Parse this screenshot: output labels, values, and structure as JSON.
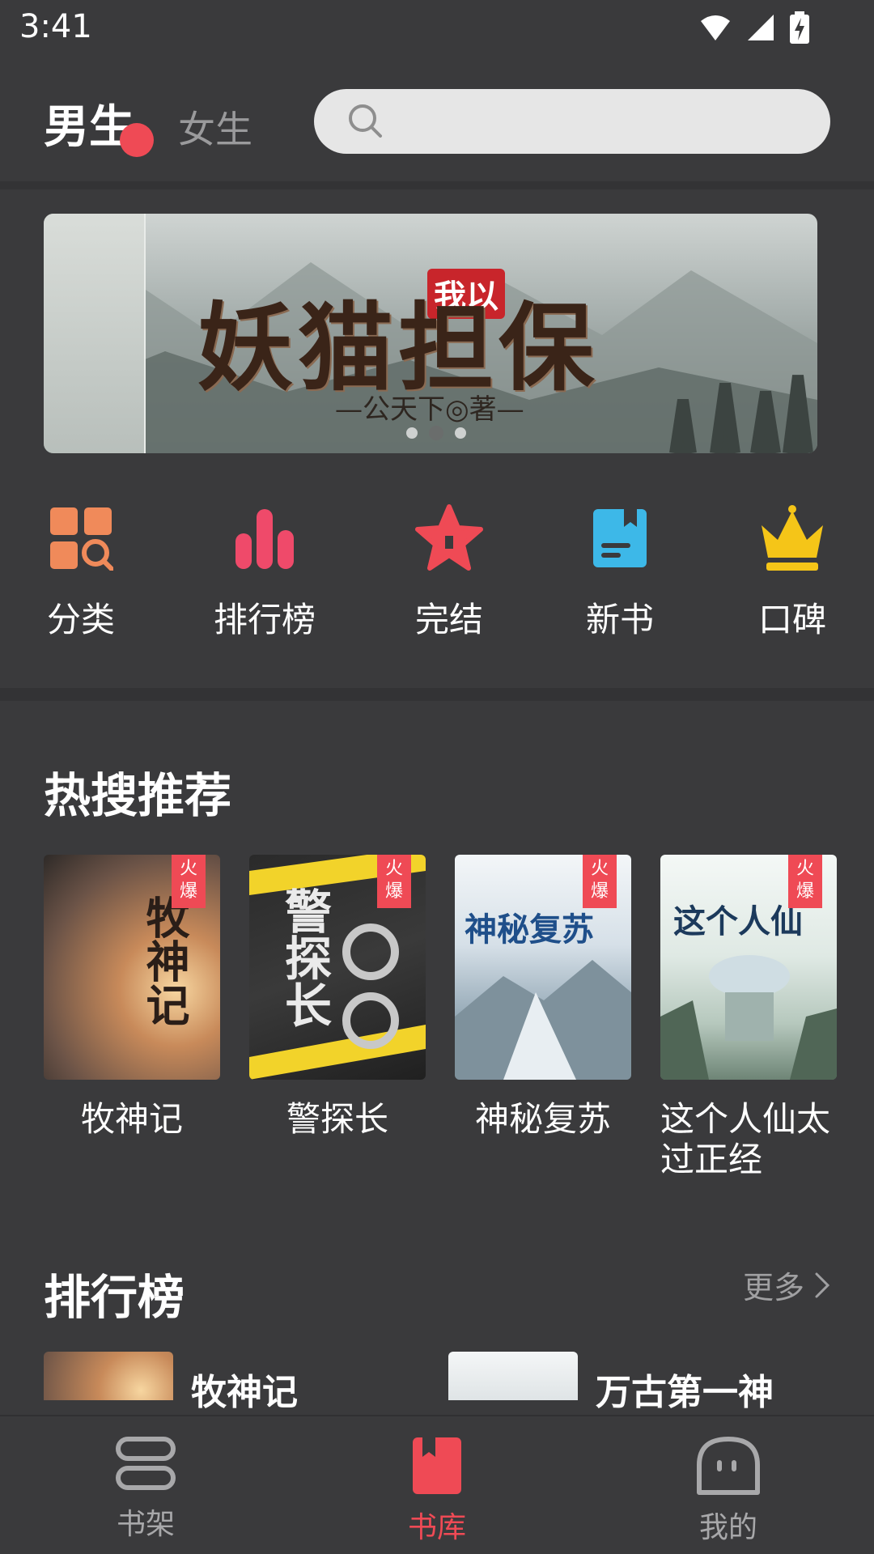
{
  "status_bar": {
    "time": "3:41",
    "icons": [
      "wifi-icon",
      "signal-icon",
      "battery-charging-icon"
    ]
  },
  "header": {
    "tabs": [
      {
        "label": "男生",
        "active": true
      },
      {
        "label": "女生",
        "active": false
      }
    ],
    "search_icon": "search-icon"
  },
  "banner": {
    "title": "妖猫担保",
    "tag": "我以",
    "author": "—公天下◎著—",
    "dots": 3,
    "active_dot": 1
  },
  "quick_nav": [
    {
      "label": "分类",
      "icon": "category-icon",
      "color": "#f08a5a"
    },
    {
      "label": "排行榜",
      "icon": "ranking-icon",
      "color": "#ef4a6a"
    },
    {
      "label": "完结",
      "icon": "star-icon",
      "color": "#ef4a55"
    },
    {
      "label": "新书",
      "icon": "book-icon",
      "color": "#3db8e8"
    },
    {
      "label": "口碑",
      "icon": "crown-icon",
      "color": "#f5c518"
    }
  ],
  "hot_section": {
    "title": "热搜推荐",
    "badge": "火爆",
    "books": [
      {
        "title": "牧神记",
        "cover_text": "牧神记"
      },
      {
        "title": "警探长",
        "cover_text": "警探长"
      },
      {
        "title": "神秘复苏",
        "cover_text": "神秘复苏"
      },
      {
        "title": "这个人仙太过正经",
        "cover_text": "这个人仙"
      }
    ]
  },
  "ranking_section": {
    "title": "排行榜",
    "more": "更多",
    "items": [
      {
        "title": "牧神记"
      },
      {
        "title": "万古第一神"
      }
    ]
  },
  "bottom_nav": [
    {
      "label": "书架",
      "icon": "bookshelf-icon",
      "active": false
    },
    {
      "label": "书库",
      "icon": "library-icon",
      "active": true
    },
    {
      "label": "我的",
      "icon": "profile-icon",
      "active": false
    }
  ],
  "colors": {
    "accent": "#ef4a55",
    "background": "#3a3a3c",
    "muted": "#9a9a9c"
  }
}
